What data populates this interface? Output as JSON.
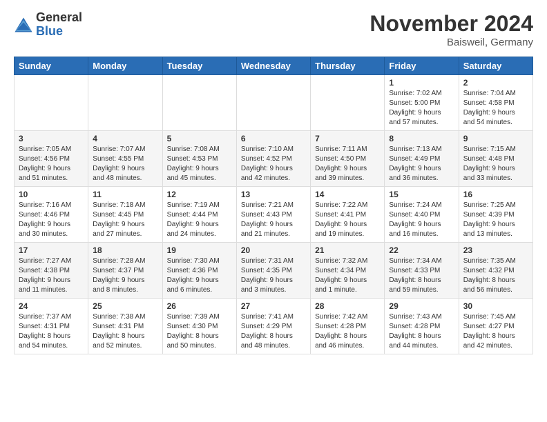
{
  "logo": {
    "general": "General",
    "blue": "Blue"
  },
  "title": "November 2024",
  "location": "Baisweil, Germany",
  "headers": [
    "Sunday",
    "Monday",
    "Tuesday",
    "Wednesday",
    "Thursday",
    "Friday",
    "Saturday"
  ],
  "weeks": [
    [
      {
        "day": "",
        "info": ""
      },
      {
        "day": "",
        "info": ""
      },
      {
        "day": "",
        "info": ""
      },
      {
        "day": "",
        "info": ""
      },
      {
        "day": "",
        "info": ""
      },
      {
        "day": "1",
        "info": "Sunrise: 7:02 AM\nSunset: 5:00 PM\nDaylight: 9 hours\nand 57 minutes."
      },
      {
        "day": "2",
        "info": "Sunrise: 7:04 AM\nSunset: 4:58 PM\nDaylight: 9 hours\nand 54 minutes."
      }
    ],
    [
      {
        "day": "3",
        "info": "Sunrise: 7:05 AM\nSunset: 4:56 PM\nDaylight: 9 hours\nand 51 minutes."
      },
      {
        "day": "4",
        "info": "Sunrise: 7:07 AM\nSunset: 4:55 PM\nDaylight: 9 hours\nand 48 minutes."
      },
      {
        "day": "5",
        "info": "Sunrise: 7:08 AM\nSunset: 4:53 PM\nDaylight: 9 hours\nand 45 minutes."
      },
      {
        "day": "6",
        "info": "Sunrise: 7:10 AM\nSunset: 4:52 PM\nDaylight: 9 hours\nand 42 minutes."
      },
      {
        "day": "7",
        "info": "Sunrise: 7:11 AM\nSunset: 4:50 PM\nDaylight: 9 hours\nand 39 minutes."
      },
      {
        "day": "8",
        "info": "Sunrise: 7:13 AM\nSunset: 4:49 PM\nDaylight: 9 hours\nand 36 minutes."
      },
      {
        "day": "9",
        "info": "Sunrise: 7:15 AM\nSunset: 4:48 PM\nDaylight: 9 hours\nand 33 minutes."
      }
    ],
    [
      {
        "day": "10",
        "info": "Sunrise: 7:16 AM\nSunset: 4:46 PM\nDaylight: 9 hours\nand 30 minutes."
      },
      {
        "day": "11",
        "info": "Sunrise: 7:18 AM\nSunset: 4:45 PM\nDaylight: 9 hours\nand 27 minutes."
      },
      {
        "day": "12",
        "info": "Sunrise: 7:19 AM\nSunset: 4:44 PM\nDaylight: 9 hours\nand 24 minutes."
      },
      {
        "day": "13",
        "info": "Sunrise: 7:21 AM\nSunset: 4:43 PM\nDaylight: 9 hours\nand 21 minutes."
      },
      {
        "day": "14",
        "info": "Sunrise: 7:22 AM\nSunset: 4:41 PM\nDaylight: 9 hours\nand 19 minutes."
      },
      {
        "day": "15",
        "info": "Sunrise: 7:24 AM\nSunset: 4:40 PM\nDaylight: 9 hours\nand 16 minutes."
      },
      {
        "day": "16",
        "info": "Sunrise: 7:25 AM\nSunset: 4:39 PM\nDaylight: 9 hours\nand 13 minutes."
      }
    ],
    [
      {
        "day": "17",
        "info": "Sunrise: 7:27 AM\nSunset: 4:38 PM\nDaylight: 9 hours\nand 11 minutes."
      },
      {
        "day": "18",
        "info": "Sunrise: 7:28 AM\nSunset: 4:37 PM\nDaylight: 9 hours\nand 8 minutes."
      },
      {
        "day": "19",
        "info": "Sunrise: 7:30 AM\nSunset: 4:36 PM\nDaylight: 9 hours\nand 6 minutes."
      },
      {
        "day": "20",
        "info": "Sunrise: 7:31 AM\nSunset: 4:35 PM\nDaylight: 9 hours\nand 3 minutes."
      },
      {
        "day": "21",
        "info": "Sunrise: 7:32 AM\nSunset: 4:34 PM\nDaylight: 9 hours\nand 1 minute."
      },
      {
        "day": "22",
        "info": "Sunrise: 7:34 AM\nSunset: 4:33 PM\nDaylight: 8 hours\nand 59 minutes."
      },
      {
        "day": "23",
        "info": "Sunrise: 7:35 AM\nSunset: 4:32 PM\nDaylight: 8 hours\nand 56 minutes."
      }
    ],
    [
      {
        "day": "24",
        "info": "Sunrise: 7:37 AM\nSunset: 4:31 PM\nDaylight: 8 hours\nand 54 minutes."
      },
      {
        "day": "25",
        "info": "Sunrise: 7:38 AM\nSunset: 4:31 PM\nDaylight: 8 hours\nand 52 minutes."
      },
      {
        "day": "26",
        "info": "Sunrise: 7:39 AM\nSunset: 4:30 PM\nDaylight: 8 hours\nand 50 minutes."
      },
      {
        "day": "27",
        "info": "Sunrise: 7:41 AM\nSunset: 4:29 PM\nDaylight: 8 hours\nand 48 minutes."
      },
      {
        "day": "28",
        "info": "Sunrise: 7:42 AM\nSunset: 4:28 PM\nDaylight: 8 hours\nand 46 minutes."
      },
      {
        "day": "29",
        "info": "Sunrise: 7:43 AM\nSunset: 4:28 PM\nDaylight: 8 hours\nand 44 minutes."
      },
      {
        "day": "30",
        "info": "Sunrise: 7:45 AM\nSunset: 4:27 PM\nDaylight: 8 hours\nand 42 minutes."
      }
    ]
  ]
}
